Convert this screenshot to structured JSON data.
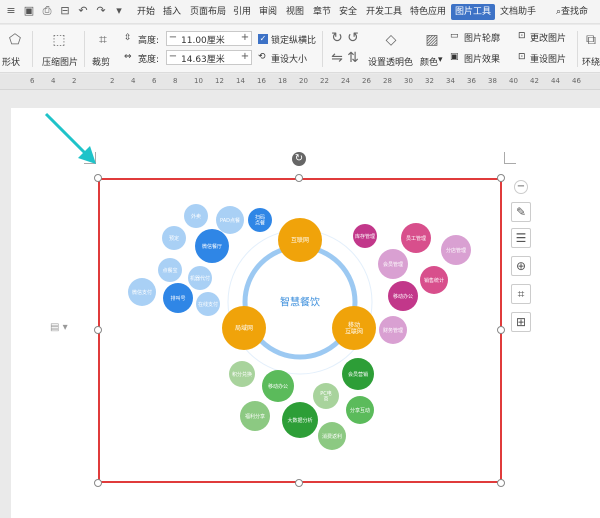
{
  "menubar": {
    "items": [
      {
        "label": "开始",
        "active": false
      },
      {
        "label": "插入",
        "active": false
      },
      {
        "label": "页面布局",
        "active": false
      },
      {
        "label": "引用",
        "active": false
      },
      {
        "label": "审阅",
        "active": false
      },
      {
        "label": "视图",
        "active": false
      },
      {
        "label": "章节",
        "active": false
      },
      {
        "label": "安全",
        "active": false
      },
      {
        "label": "开发工具",
        "active": false
      },
      {
        "label": "特色应用",
        "active": false
      },
      {
        "label": "图片工具",
        "active": true
      },
      {
        "label": "文档助手",
        "active": false
      }
    ],
    "search_label": "查找命"
  },
  "ribbon": {
    "shape_label": "形状",
    "compress_label": "压缩图片",
    "crop_label": "裁剪",
    "height_label": "高度:",
    "height_value": "11.00厘米",
    "width_label": "宽度:",
    "width_value": "14.63厘米",
    "lock_ratio_label": "锁定纵横比",
    "reset_size_label": "重设大小",
    "transparent_label": "设置透明色",
    "color_label": "颜色",
    "outline_label": "图片轮廓",
    "effect_label": "图片效果",
    "change_label": "更改图片",
    "reset_label": "重设图片",
    "wrap_label": "环绕"
  },
  "ruler": {
    "ticks": [
      "6",
      "4",
      "2",
      "2",
      "4",
      "6",
      "8",
      "10",
      "12",
      "14",
      "16",
      "18",
      "20",
      "22",
      "24",
      "26",
      "28",
      "30",
      "32",
      "34",
      "36",
      "38",
      "40",
      "42",
      "44",
      "46"
    ]
  },
  "mindmap": {
    "center": "智慧餐饮",
    "hubs": [
      {
        "label": "互联网",
        "color": "#f0a30a"
      },
      {
        "label": "移动\n互联网",
        "color": "#f0a30a"
      },
      {
        "label": "局域网",
        "color": "#f0a30a"
      }
    ],
    "blue_nodes": [
      "外卖",
      "PAD点餐",
      "扫码\n点餐",
      "预定",
      "微信餐厅",
      "点餐宝",
      "机器代付",
      "微信支付",
      "排叫号",
      "在线支付"
    ],
    "pink_nodes": [
      "库存管理",
      "员工管理",
      "会员管理",
      "分店管理",
      "销售统计",
      "移动办公",
      "财务管理"
    ],
    "green_nodes": [
      "积分兑换",
      "移动办公",
      "会员营销",
      "PC电\n商",
      "福利分享",
      "大数据分析",
      "分享互动",
      "消费返利"
    ]
  },
  "colors": {
    "frame": "#e03b3b",
    "accent": "#3d72c6",
    "arrow": "#1fc3c9"
  }
}
